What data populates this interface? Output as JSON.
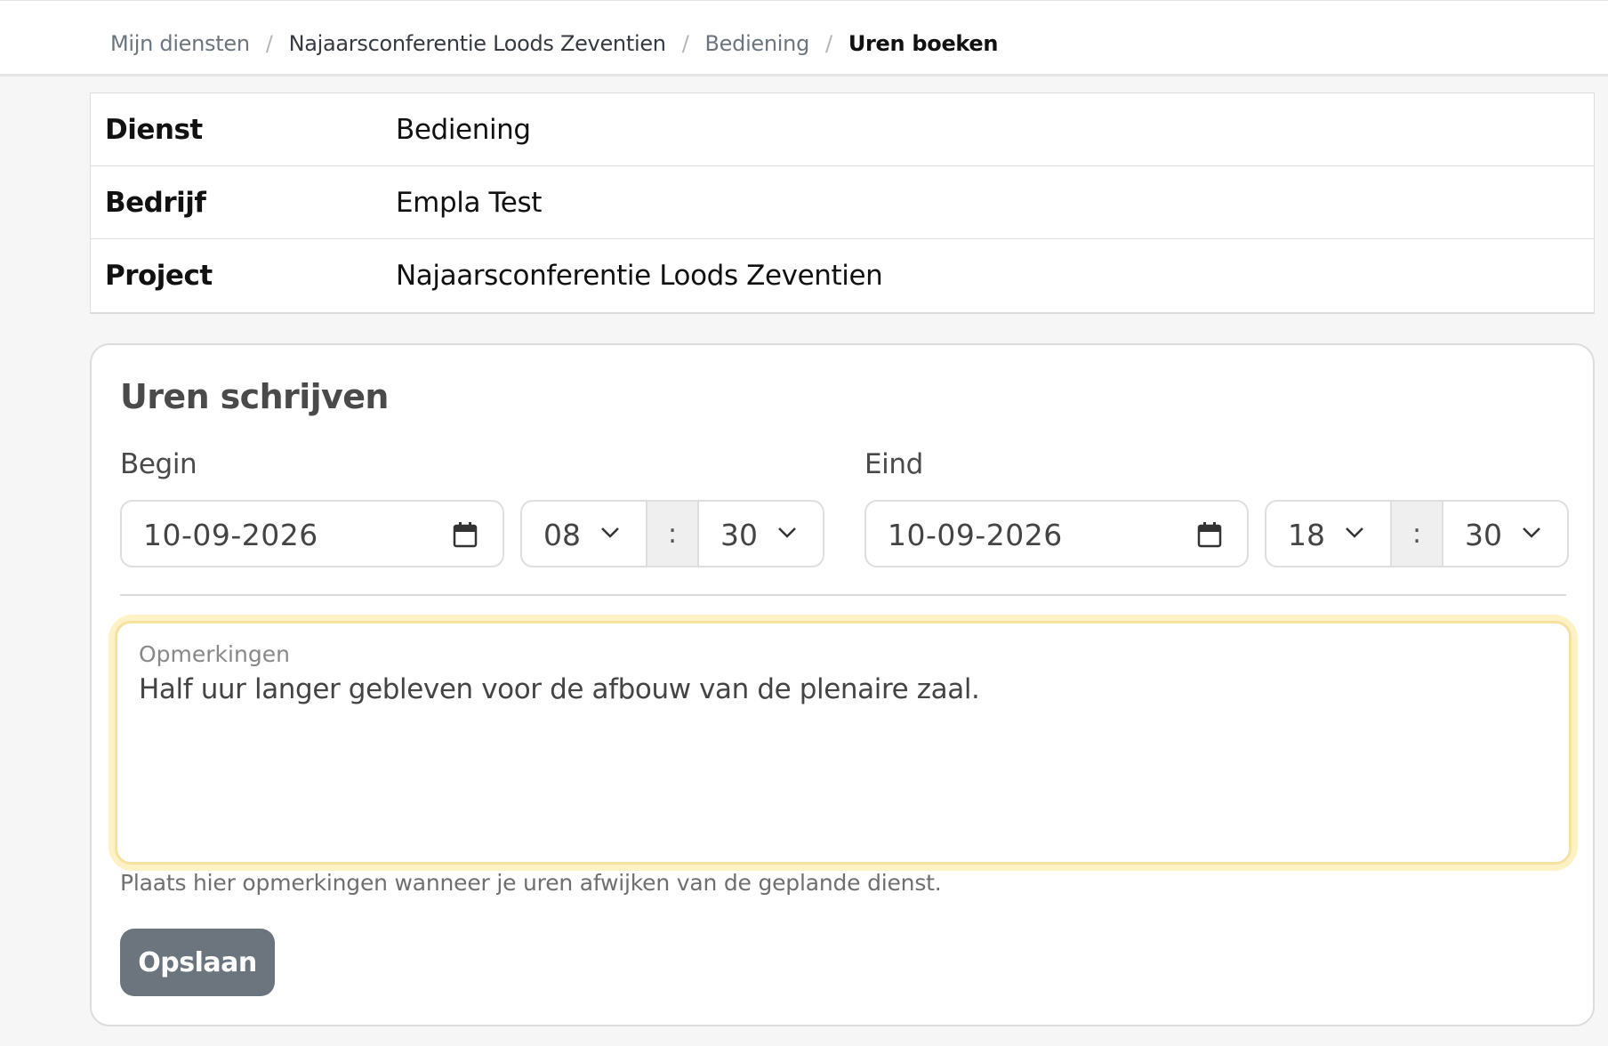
{
  "breadcrumb": {
    "items": [
      "Mijn diensten",
      "Najaarsconferentie Loods Zeventien",
      "Bediening"
    ],
    "current": "Uren boeken",
    "separator": "/"
  },
  "info": {
    "rows": [
      {
        "label": "Dienst",
        "value": "Bediening"
      },
      {
        "label": "Bedrijf",
        "value": "Empla Test"
      },
      {
        "label": "Project",
        "value": "Najaarsconferentie Loods Zeventien"
      }
    ]
  },
  "form": {
    "title": "Uren schrijven",
    "begin": {
      "label": "Begin",
      "date": "10-09-2026",
      "hour": "08",
      "minute": "30"
    },
    "end": {
      "label": "Eind",
      "date": "10-09-2026",
      "hour": "18",
      "minute": "30"
    },
    "time_separator": ":",
    "remarks": {
      "label": "Opmerkingen",
      "value": "Half uur langer gebleven voor de afbouw van de plenaire zaal."
    },
    "help_text": "Plaats hier opmerkingen wanneer je uren afwijken van de geplande dienst.",
    "save_label": "Opslaan"
  },
  "icons": {
    "date_picker": "calendar-icon",
    "select": "chevron-down-icon"
  },
  "colors": {
    "button": "#6c757d",
    "focus_ring": "#fdf2c6"
  }
}
